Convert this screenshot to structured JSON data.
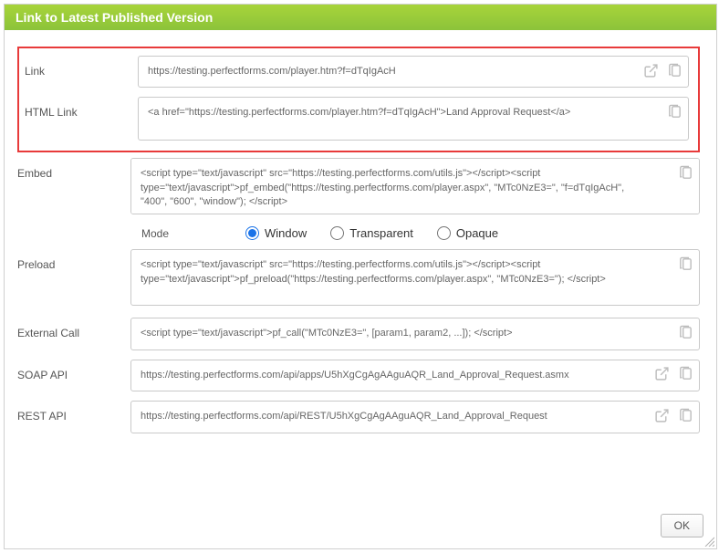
{
  "panel": {
    "title": "Link to Latest Published Version"
  },
  "fields": {
    "link": {
      "label": "Link",
      "value": "https://testing.perfectforms.com/player.htm?f=dTqIgAcH"
    },
    "htmlLink": {
      "label": "HTML Link",
      "value": "<a href=\"https://testing.perfectforms.com/player.htm?f=dTqIgAcH\">Land Approval Request</a>"
    },
    "embed": {
      "label": "Embed",
      "value": "<script type=\"text/javascript\" src=\"https://testing.perfectforms.com/utils.js\"></script><script type=\"text/javascript\">pf_embed(\"https://testing.perfectforms.com/player.aspx\", \"MTc0NzE3=\", \"f=dTqIgAcH\", \"400\", \"600\", \"window\"); </script>"
    },
    "preload": {
      "label": "Preload",
      "value": "<script type=\"text/javascript\" src=\"https://testing.perfectforms.com/utils.js\"></script><script type=\"text/javascript\">pf_preload(\"https://testing.perfectforms.com/player.aspx\", \"MTc0NzE3=\"); </script>"
    },
    "externalCall": {
      "label": "External Call",
      "value": "<script type=\"text/javascript\">pf_call(\"MTc0NzE3=\", [param1, param2, ...]); </script>"
    },
    "soapApi": {
      "label": "SOAP API",
      "value": "https://testing.perfectforms.com/api/apps/U5hXgCgAgAAguAQR_Land_Approval_Request.asmx"
    },
    "restApi": {
      "label": "REST API",
      "value": "https://testing.perfectforms.com/api/REST/U5hXgCgAgAAguAQR_Land_Approval_Request"
    }
  },
  "mode": {
    "label": "Mode",
    "options": [
      "Window",
      "Transparent",
      "Opaque"
    ],
    "selected": "Window"
  },
  "buttons": {
    "ok": "OK"
  }
}
